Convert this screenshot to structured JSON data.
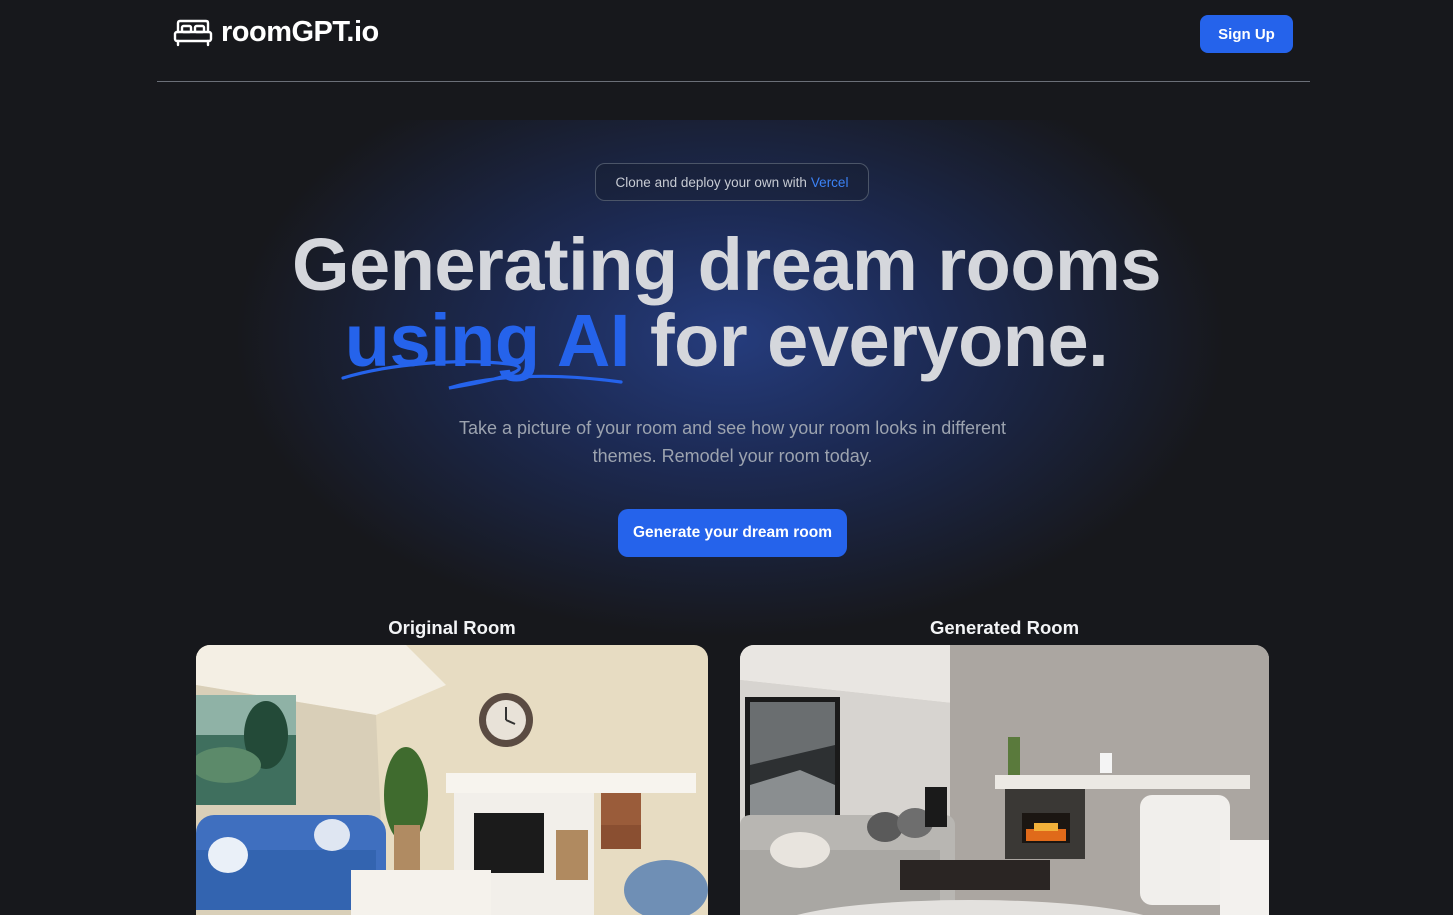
{
  "header": {
    "logo_text": "roomGPT.io",
    "logo_icon": "bed-icon",
    "signup_label": "Sign Up"
  },
  "badge": {
    "text": "Clone and deploy your own with",
    "link_text": "Vercel"
  },
  "hero": {
    "line1": "Generating dream rooms",
    "accent": "using AI",
    "line2_rest": "for everyone.",
    "subtitle": "Take a picture of your room and see how your room looks in different themes. Remodel your room today.",
    "cta_label": "Generate your dream room"
  },
  "comparison": {
    "original_label": "Original Room",
    "generated_label": "Generated Room"
  },
  "colors": {
    "background": "#17181c",
    "accent": "#2563eb",
    "heading": "#d5d7dc",
    "muted": "#9ca3af"
  }
}
